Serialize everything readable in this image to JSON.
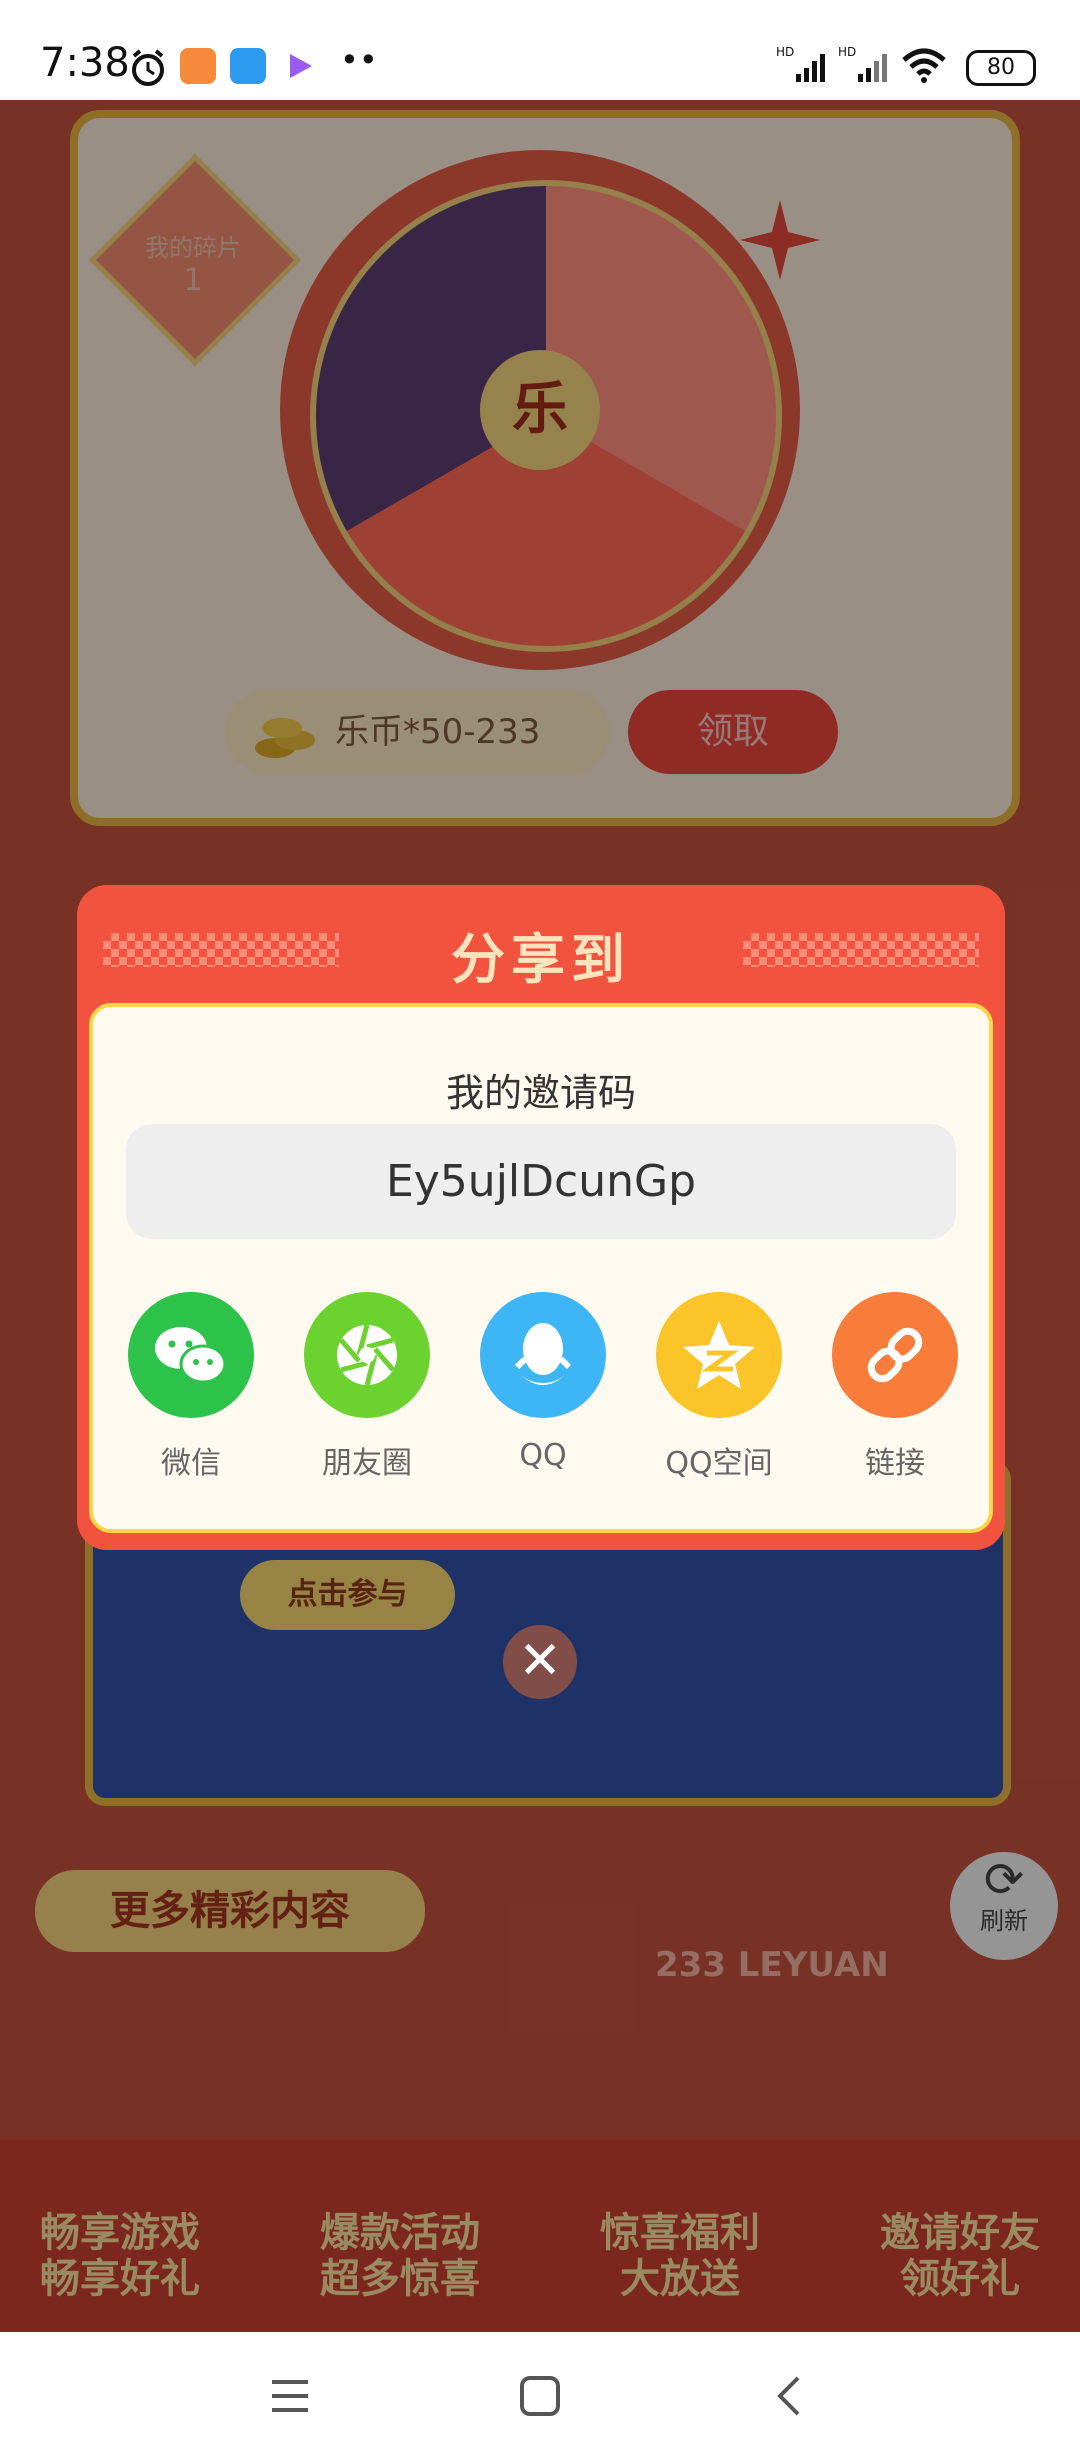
{
  "status_bar": {
    "time": "7:38",
    "battery": "80"
  },
  "background": {
    "fragments_label": "我的碎片",
    "fragments_count": "1",
    "wheel_center": "乐",
    "coin_reward": "乐币*50-233",
    "claim_button": "领取",
    "join_button": "点击参与",
    "more_content": "更多精彩内容",
    "brand_text": "233 LEYUAN",
    "refresh_label": "刷新",
    "features": [
      {
        "line1": "畅享游戏",
        "line2": "畅享好礼"
      },
      {
        "line1": "爆款活动",
        "line2": "超多惊喜"
      },
      {
        "line1": "惊喜福利",
        "line2": "大放送"
      },
      {
        "line1": "邀请好友",
        "line2": "领好礼"
      }
    ]
  },
  "dialog": {
    "title": "分享到",
    "invite_label": "我的邀请码",
    "invite_code": "Ey5ujlDcunGp",
    "share_targets": [
      {
        "label": "微信",
        "icon": "wechat-icon",
        "color": "#2dc24a"
      },
      {
        "label": "朋友圈",
        "icon": "moments-icon",
        "color": "#6bd22f"
      },
      {
        "label": "QQ",
        "icon": "qq-icon",
        "color": "#3eb5f5"
      },
      {
        "label": "QQ空间",
        "icon": "qzone-icon",
        "color": "#fbc52a"
      },
      {
        "label": "链接",
        "icon": "link-icon",
        "color": "#f87c3a"
      }
    ]
  },
  "colors": {
    "dialog_bg": "#f2533f",
    "dialog_body": "#fffaf0",
    "accent_border": "#ffd64a"
  }
}
